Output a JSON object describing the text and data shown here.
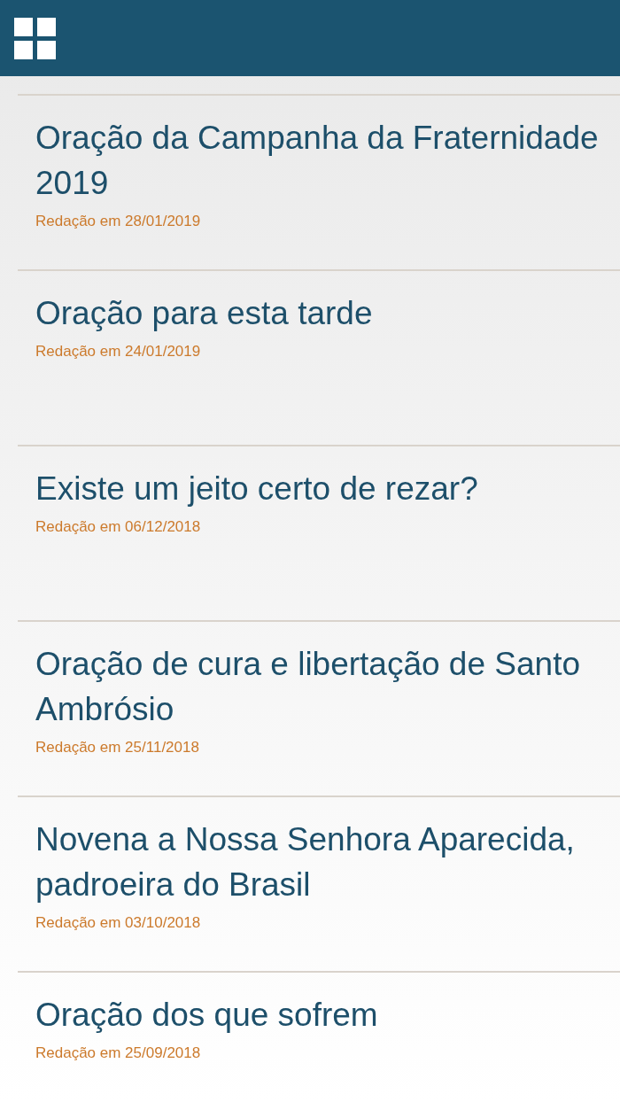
{
  "articles": [
    {
      "title": "Oração da Campanha da Fraternidade 2019",
      "date": "Redação em 28/01/2019"
    },
    {
      "title": "Oração para esta tarde",
      "date": "Redação em 24/01/2019"
    },
    {
      "title": "Existe um jeito certo de rezar?",
      "date": "Redação em 06/12/2018"
    },
    {
      "title": "Oração de cura e libertação de Santo Ambrósio",
      "date": "Redação em 25/11/2018"
    },
    {
      "title": "Novena a Nossa Senhora Aparecida, padroeira do Brasil",
      "date": "Redação em 03/10/2018"
    },
    {
      "title": "Oração dos que sofrem",
      "date": "Redação em 25/09/2018"
    }
  ]
}
